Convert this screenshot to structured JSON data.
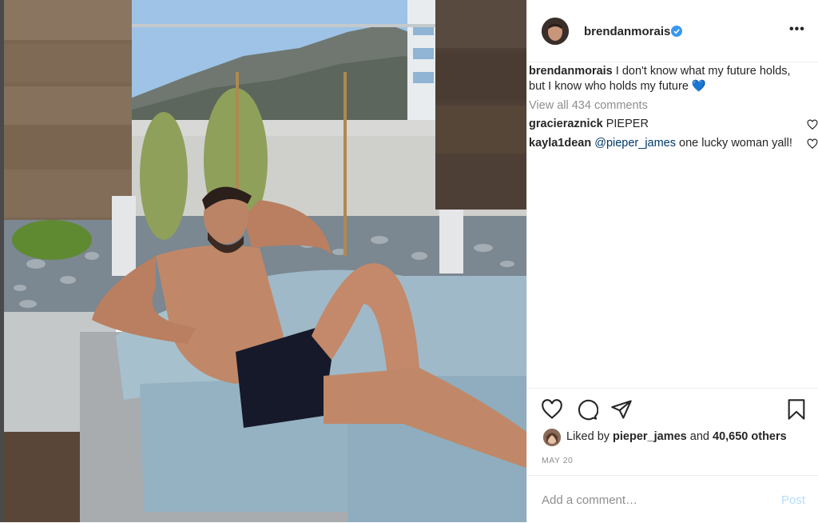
{
  "post": {
    "username": "brendanmorais",
    "more_label": "•••",
    "caption_user": "brendanmorais",
    "caption_text": " I don't know what my future holds, but I know who holds my future 💙",
    "view_all": "View all 434 comments",
    "comments": [
      {
        "user": "gracieraznick",
        "text": " PIEPER",
        "mention": ""
      },
      {
        "user": "kayla1dean",
        "text": " one lucky woman yall!",
        "mention": " @pieper_james"
      }
    ],
    "likes_prefix": "Liked by ",
    "likes_user": "pieper_james",
    "likes_mid": " and ",
    "likes_count": "40,650 others",
    "date": "MAY 20",
    "add_comment_placeholder": "Add a comment…",
    "post_button": "Post"
  },
  "icons": {
    "verified": "verified-badge-icon",
    "like": "heart-icon",
    "comment": "comment-bubble-icon",
    "share": "paper-plane-icon",
    "save": "bookmark-icon"
  },
  "colors": {
    "accent_blue": "#3897f0",
    "mention": "#00376b",
    "muted": "#8e8e8e",
    "post_disabled": "#b2dffc"
  }
}
